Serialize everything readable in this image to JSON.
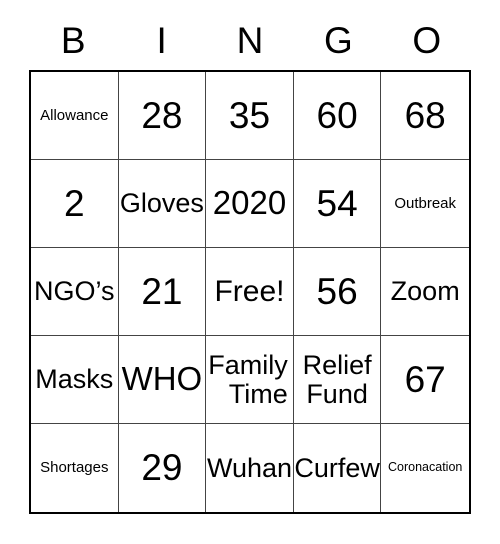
{
  "card": {
    "title_letters": [
      "B",
      "I",
      "N",
      "G",
      "O"
    ],
    "free_space_label": "Free!",
    "border_color": "#000000",
    "grid_line_color": "#444444",
    "text_color": "#000000",
    "background_color": "#ffffff",
    "rows": [
      [
        {
          "text": "Allowance",
          "size": "sm",
          "align": "center"
        },
        {
          "text": "28",
          "size": "num",
          "align": "center"
        },
        {
          "text": "35",
          "size": "num",
          "align": "center"
        },
        {
          "text": "60",
          "size": "num",
          "align": "center"
        },
        {
          "text": "68",
          "size": "num",
          "align": "center"
        }
      ],
      [
        {
          "text": "2",
          "size": "num",
          "align": "center"
        },
        {
          "text": "Gloves",
          "size": "md",
          "align": "center"
        },
        {
          "text": "2020",
          "size": "xl",
          "align": "center"
        },
        {
          "text": "54",
          "size": "num",
          "align": "center"
        },
        {
          "text": "Outbreak",
          "size": "sm",
          "align": "center"
        }
      ],
      [
        {
          "text": "NGO’s",
          "size": "md",
          "align": "center"
        },
        {
          "text": "21",
          "size": "num",
          "align": "center"
        },
        {
          "text": "Free!",
          "size": "lg",
          "align": "center"
        },
        {
          "text": "56",
          "size": "num",
          "align": "center"
        },
        {
          "text": "Zoom",
          "size": "md",
          "align": "center"
        }
      ],
      [
        {
          "text": "Masks",
          "size": "md",
          "align": "center"
        },
        {
          "text": "WHO",
          "size": "xl",
          "align": "center"
        },
        {
          "text": "Family\nTime",
          "size": "md",
          "align": "right"
        },
        {
          "text": "Relief\nFund",
          "size": "md",
          "align": "center"
        },
        {
          "text": "67",
          "size": "num",
          "align": "center"
        }
      ],
      [
        {
          "text": "Shortages",
          "size": "sm",
          "align": "center"
        },
        {
          "text": "29",
          "size": "num",
          "align": "center"
        },
        {
          "text": "Wuhan",
          "size": "md",
          "align": "center"
        },
        {
          "text": "Curfew",
          "size": "md",
          "align": "center"
        },
        {
          "text": "Coronacation",
          "size": "xs",
          "align": "center"
        }
      ]
    ]
  }
}
